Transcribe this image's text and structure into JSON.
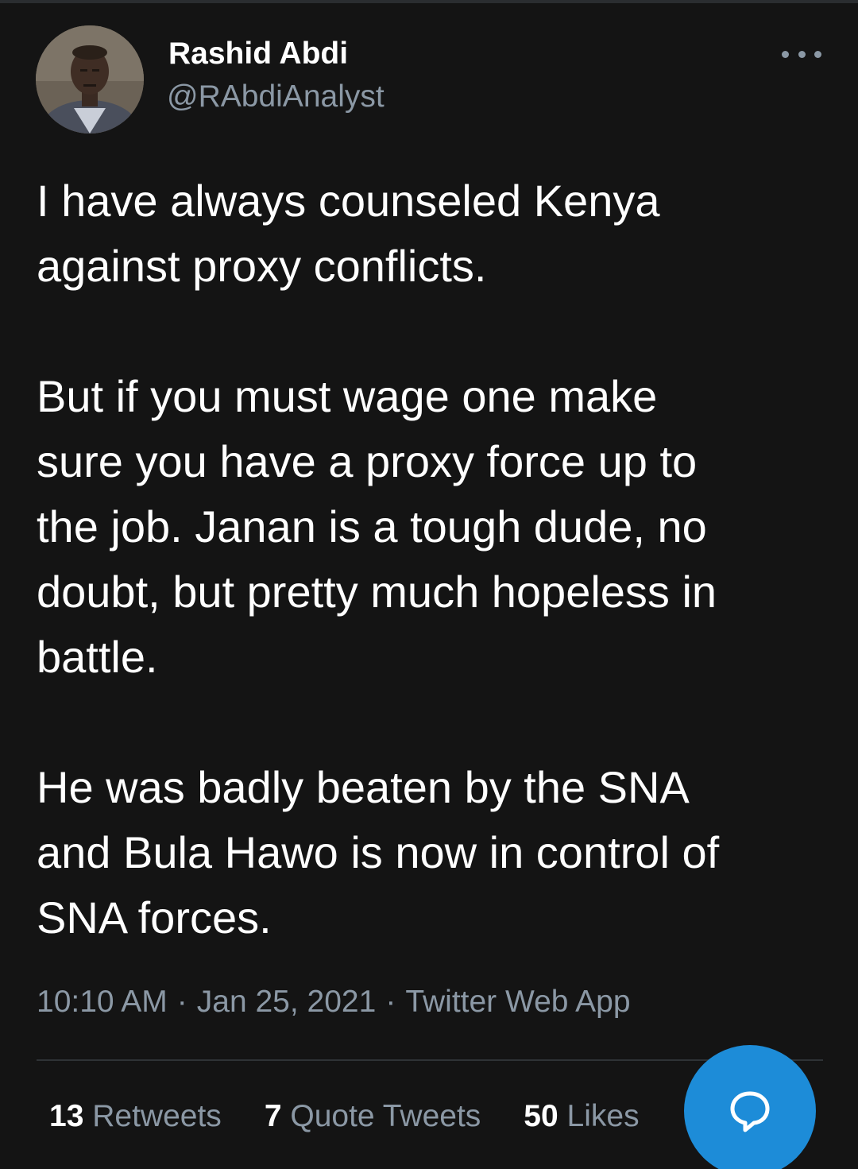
{
  "author": {
    "name": "Rashid Abdi",
    "handle": "@RAbdiAnalyst"
  },
  "tweet": {
    "paragraphs": [
      "I have always counseled Kenya\nagainst proxy conflicts.",
      "But if you must wage one make\nsure you have a proxy force up to\nthe job. Janan is a tough dude, no\ndoubt, but pretty much hopeless in\nbattle.",
      "He was badly beaten by the SNA\nand Bula Hawo is now in control of\nSNA forces."
    ],
    "time": "10:10 AM",
    "date": "Jan 25, 2021",
    "source": "Twitter Web App",
    "separator": "·"
  },
  "stats": {
    "retweets_count": "13",
    "retweets_label": "Retweets",
    "quotes_count": "7",
    "quotes_label": "Quote Tweets",
    "likes_count": "50",
    "likes_label": "Likes"
  },
  "icons": {
    "more": "more-horizontal-icon",
    "compose": "reply-bubble-icon"
  },
  "colors": {
    "background": "#141414",
    "text": "#ffffff",
    "secondary": "#8b98a5",
    "accent": "#1d8cd8"
  }
}
